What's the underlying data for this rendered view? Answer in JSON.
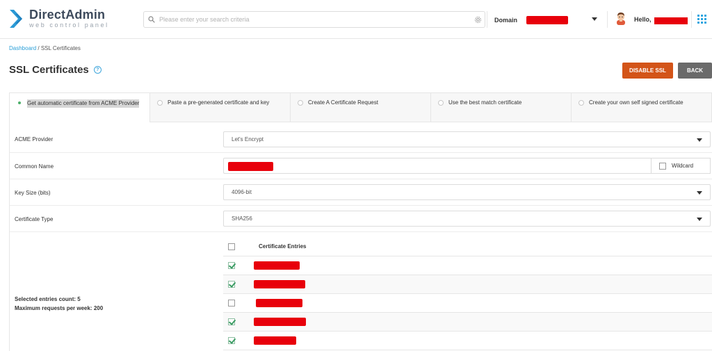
{
  "header": {
    "logo_title": "DirectAdmin",
    "logo_subtitle": "web control panel",
    "search_placeholder": "Please enter your search criteria",
    "domain_label": "Domain",
    "hello_label": "Hello,"
  },
  "breadcrumb": {
    "root": "Dashboard",
    "separator": " / ",
    "current": "SSL Certificates"
  },
  "page": {
    "title": "SSL Certificates",
    "help": "?"
  },
  "buttons": {
    "disable_ssl": "DISABLE SSL",
    "back": "BACK"
  },
  "tabs": [
    {
      "label": "Get automatic certificate from ACME Provider",
      "selected": true
    },
    {
      "label": "Paste a pre-generated certificate and key",
      "selected": false
    },
    {
      "label": "Create A Certificate Request",
      "selected": false
    },
    {
      "label": "Use the best match certificate",
      "selected": false
    },
    {
      "label": "Create your own self signed certificate",
      "selected": false
    }
  ],
  "form": {
    "acme_provider": {
      "label": "ACME Provider",
      "value": "Let's Encrypt"
    },
    "common_name": {
      "label": "Common Name",
      "wildcard_label": "Wildcard"
    },
    "key_size": {
      "label": "Key Size (bits)",
      "value": "4096-bit"
    },
    "certificate_type": {
      "label": "Certificate Type",
      "value": "SHA256"
    }
  },
  "summary": {
    "selected_count": "Selected entries count: 5",
    "max_requests": "Maximum requests per week: 200"
  },
  "entries": {
    "header": "Certificate Entries",
    "items": [
      {
        "checked": true
      },
      {
        "checked": true
      },
      {
        "checked": false
      },
      {
        "checked": true
      },
      {
        "checked": true
      }
    ]
  },
  "colors": {
    "accent": "#2a9fd8",
    "disable_ssl": "#d35418",
    "back": "#6a6a6a",
    "redaction": "#e8000b",
    "checkmark": "#3a9c63"
  }
}
